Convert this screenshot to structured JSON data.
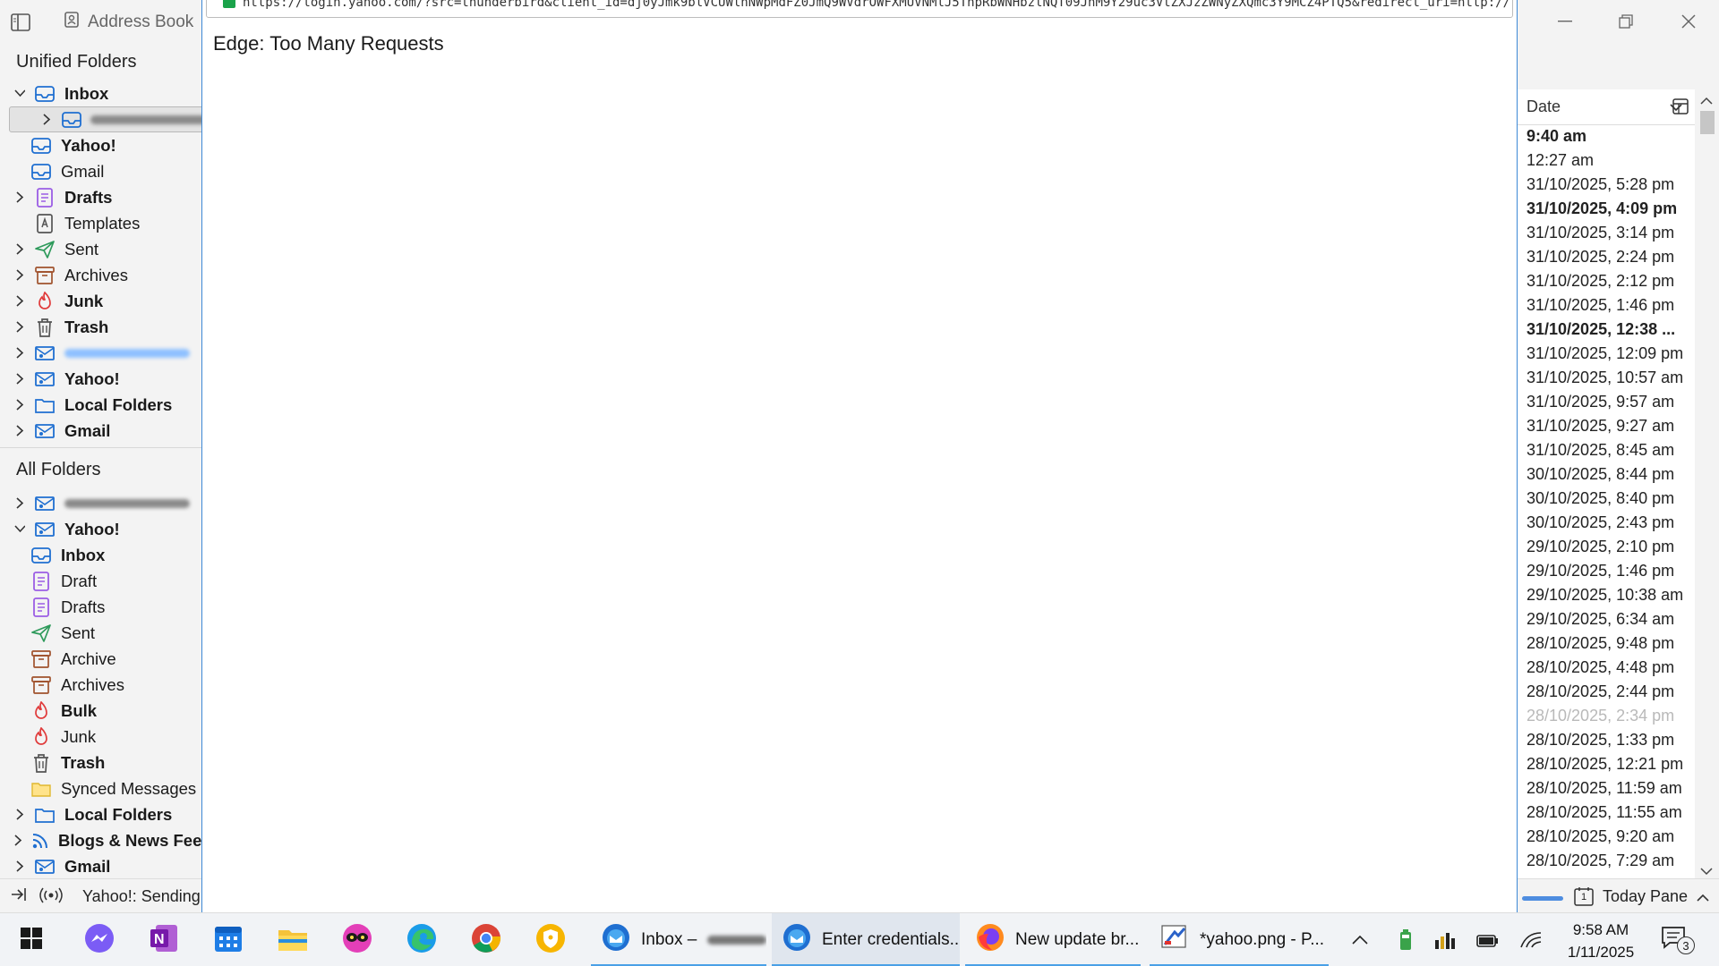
{
  "tb_window": {
    "address_book": "Address Book",
    "unified_header": "Unified Folders",
    "all_header": "All Folders",
    "unified_rows": [
      {
        "name": "Inbox",
        "icon": "inbox-icon",
        "twisty": "open",
        "bold": true,
        "level": 0
      },
      {
        "name": "",
        "icon": "inbox-icon",
        "twisty": "closed",
        "bold": false,
        "level": 1,
        "redacted": true,
        "selected": true
      },
      {
        "name": "Yahoo!",
        "icon": "inbox-icon",
        "twisty": "",
        "bold": true,
        "level": 1
      },
      {
        "name": "Gmail",
        "icon": "inbox-icon",
        "twisty": "",
        "bold": false,
        "level": 1
      },
      {
        "name": "Drafts",
        "icon": "drafts-icon",
        "twisty": "closed",
        "bold": true,
        "level": 0
      },
      {
        "name": "Templates",
        "icon": "template-icon",
        "twisty": "",
        "bold": false,
        "level": 0
      },
      {
        "name": "Sent",
        "icon": "sent-icon",
        "twisty": "closed",
        "bold": false,
        "level": 0
      },
      {
        "name": "Archives",
        "icon": "archive-icon",
        "twisty": "closed",
        "bold": false,
        "level": 0
      },
      {
        "name": "Junk",
        "icon": "junk-icon",
        "twisty": "closed",
        "bold": true,
        "level": 0
      },
      {
        "name": "Trash",
        "icon": "trash-icon",
        "twisty": "closed",
        "bold": true,
        "level": 0
      },
      {
        "name": "",
        "icon": "account-icon",
        "twisty": "closed",
        "bold": false,
        "level": 0,
        "redacted": true
      },
      {
        "name": "Yahoo!",
        "icon": "account-icon",
        "twisty": "closed",
        "bold": true,
        "level": 0
      },
      {
        "name": "Local Folders",
        "icon": "folder-icon",
        "twisty": "closed",
        "bold": true,
        "level": 0
      },
      {
        "name": "Gmail",
        "icon": "account-icon",
        "twisty": "closed",
        "bold": true,
        "level": 0
      }
    ],
    "all_rows": [
      {
        "name": "",
        "icon": "account-icon",
        "twisty": "closed",
        "bold": false,
        "level": 0,
        "redacted": true
      },
      {
        "name": "Yahoo!",
        "icon": "account-icon",
        "twisty": "open",
        "bold": true,
        "level": 0
      },
      {
        "name": "Inbox",
        "icon": "inbox-icon",
        "twisty": "",
        "bold": true,
        "level": 1
      },
      {
        "name": "Draft",
        "icon": "drafts-icon",
        "twisty": "",
        "bold": false,
        "level": 1
      },
      {
        "name": "Drafts",
        "icon": "drafts-icon",
        "twisty": "",
        "bold": false,
        "level": 1
      },
      {
        "name": "Sent",
        "icon": "sent-icon",
        "twisty": "",
        "bold": false,
        "level": 1
      },
      {
        "name": "Archive",
        "icon": "archive-icon",
        "twisty": "",
        "bold": false,
        "level": 1
      },
      {
        "name": "Archives",
        "icon": "archive-icon",
        "twisty": "",
        "bold": false,
        "level": 1
      },
      {
        "name": "Bulk",
        "icon": "junk-icon",
        "twisty": "",
        "bold": true,
        "level": 1
      },
      {
        "name": "Junk",
        "icon": "junk-icon",
        "twisty": "",
        "bold": false,
        "level": 1
      },
      {
        "name": "Trash",
        "icon": "trash-icon",
        "twisty": "",
        "bold": true,
        "level": 1
      },
      {
        "name": "Synced Messages",
        "icon": "yellow-folder-icon",
        "twisty": "",
        "bold": false,
        "level": 1
      },
      {
        "name": "Local Folders",
        "icon": "folder-icon",
        "twisty": "closed",
        "bold": true,
        "level": 0
      },
      {
        "name": "Blogs & News Feeds",
        "icon": "rss-icon",
        "twisty": "closed",
        "bold": true,
        "level": 0
      },
      {
        "name": "Gmail",
        "icon": "account-icon",
        "twisty": "closed",
        "bold": true,
        "level": 0
      }
    ],
    "date_column_label": "Date",
    "dates": [
      {
        "text": "9:40 am",
        "bold": true
      },
      {
        "text": "12:27 am"
      },
      {
        "text": "31/10/2025, 5:28 pm"
      },
      {
        "text": "31/10/2025, 4:09 pm",
        "bold": true
      },
      {
        "text": "31/10/2025, 3:14 pm"
      },
      {
        "text": "31/10/2025, 2:24 pm"
      },
      {
        "text": "31/10/2025, 2:12 pm"
      },
      {
        "text": "31/10/2025, 1:46 pm"
      },
      {
        "text": "31/10/2025, 12:38 ...",
        "bold": true
      },
      {
        "text": "31/10/2025, 12:09 pm"
      },
      {
        "text": "31/10/2025, 10:57 am"
      },
      {
        "text": "31/10/2025, 9:57 am"
      },
      {
        "text": "31/10/2025, 9:27 am"
      },
      {
        "text": "31/10/2025, 8:45 am"
      },
      {
        "text": "30/10/2025, 8:44 pm"
      },
      {
        "text": "30/10/2025, 8:40 pm"
      },
      {
        "text": "30/10/2025, 2:43 pm"
      },
      {
        "text": "29/10/2025, 2:10 pm"
      },
      {
        "text": "29/10/2025, 1:46 pm"
      },
      {
        "text": "29/10/2025, 10:38 am"
      },
      {
        "text": "29/10/2025, 6:34 am"
      },
      {
        "text": "28/10/2025, 9:48 pm"
      },
      {
        "text": "28/10/2025, 4:48 pm"
      },
      {
        "text": "28/10/2025, 2:44 pm"
      },
      {
        "text": "28/10/2025, 2:34 pm",
        "dim": true
      },
      {
        "text": "28/10/2025, 1:33 pm"
      },
      {
        "text": "28/10/2025, 12:21 pm"
      },
      {
        "text": "28/10/2025, 11:59 am"
      },
      {
        "text": "28/10/2025, 11:55 am"
      },
      {
        "text": "28/10/2025, 9:20 am"
      },
      {
        "text": "28/10/2025, 7:29 am"
      }
    ],
    "status_text": "Yahoo!: Sending",
    "today_pane": "Today Pane",
    "calendar_day": "1"
  },
  "popup": {
    "url": "https://login.yahoo.com/?src=thunderbird&client_id=dj0yJmk9blVCUWlhNWpMdFZ0JmQ9WVdrOWFXMUVNMlJ5TnpRbWNHbzlNQT09JnM9Y29uc3VtZXJzZWNyZXQmc3Y9MCZ4PTQ5&redirect_uri=http://localhost&response_type=code",
    "heading": "Edge: Too Many Requests"
  },
  "taskbar": {
    "buttons": [
      {
        "label": "Inbox –",
        "icon": "thunderbird-icon",
        "redacted": true
      },
      {
        "label": "Enter credentials...",
        "icon": "thunderbird-icon",
        "active": true
      },
      {
        "label": "New update br...",
        "icon": "firefox-icon"
      },
      {
        "label": "*yahoo.png - P...",
        "icon": "paint-icon"
      }
    ],
    "time": "9:58 AM",
    "date": "1/11/2025",
    "notification_count": "3",
    "colors": {
      "accent": "#4aa0e6",
      "popup_border": "#3d89d6"
    }
  }
}
